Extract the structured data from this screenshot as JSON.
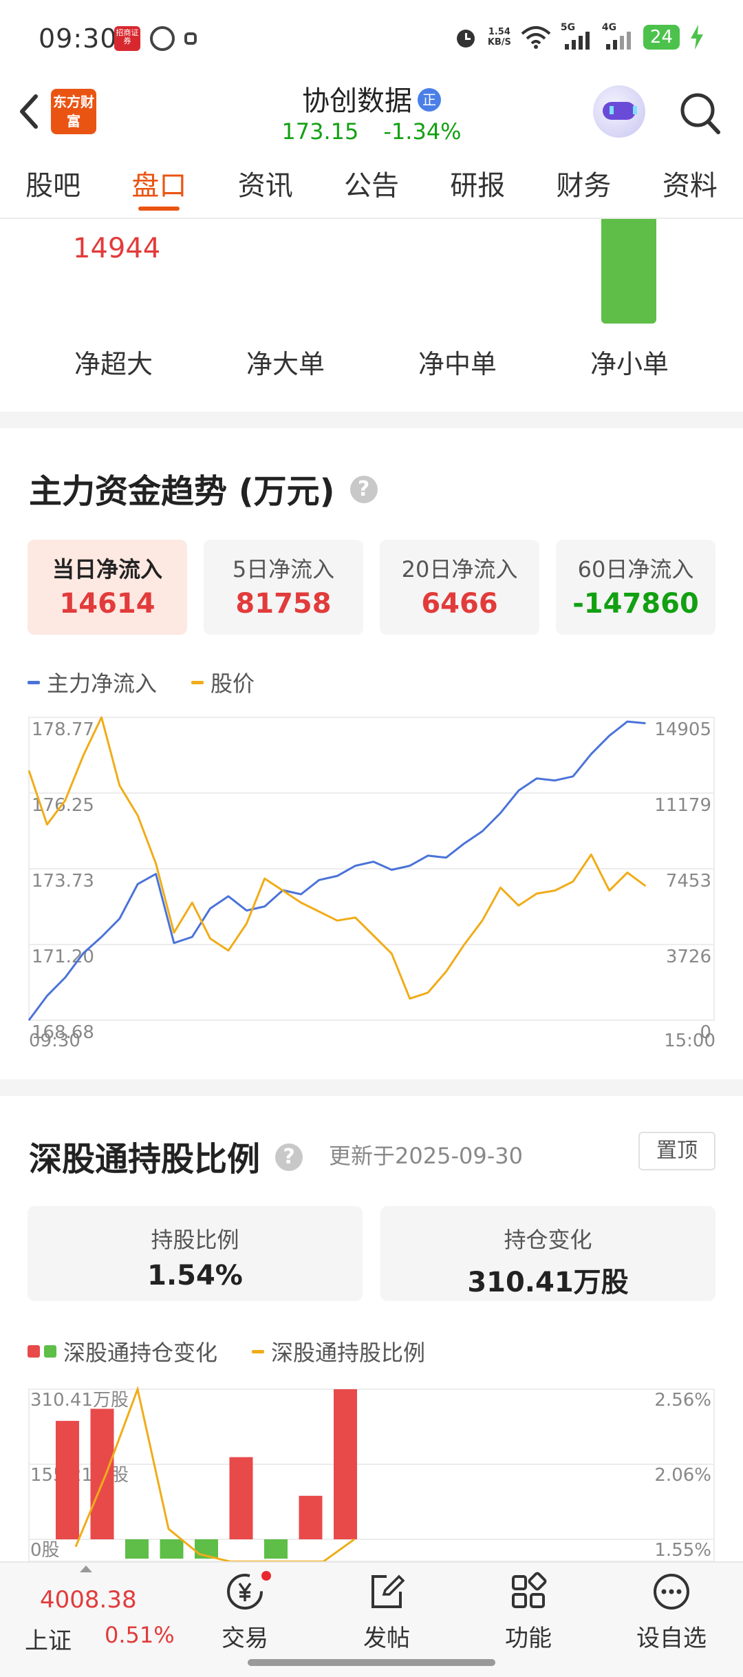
{
  "status_bar": {
    "time": "09:30",
    "app_badge": "招商证券",
    "net_speed_value": "1.54",
    "net_speed_unit": "KB/S",
    "signal_5g": "5G",
    "signal_4g": "4G",
    "battery": "24"
  },
  "header": {
    "logo_text": "东方财富",
    "stock_name": "协创数据",
    "badge": "正",
    "price": "173.15",
    "change_pct": "-1.34%"
  },
  "tabs": [
    {
      "label": "股吧",
      "active": false
    },
    {
      "label": "盘口",
      "active": true
    },
    {
      "label": "资讯",
      "active": false
    },
    {
      "label": "公告",
      "active": false
    },
    {
      "label": "研报",
      "active": false
    },
    {
      "label": "财务",
      "active": false
    },
    {
      "label": "资料",
      "active": false
    }
  ],
  "fund_bars": {
    "top_value": "14944",
    "labels": [
      "净超大",
      "净大单",
      "净中单",
      "净小单"
    ]
  },
  "trend_section": {
    "title": "主力资金趋势 (万元)",
    "help": "?",
    "cards": [
      {
        "label": "当日净流入",
        "value": "14614",
        "active": true,
        "color": "red"
      },
      {
        "label": "5日净流入",
        "value": "81758",
        "active": false,
        "color": "red"
      },
      {
        "label": "20日净流入",
        "value": "6466",
        "active": false,
        "color": "red"
      },
      {
        "label": "60日净流入",
        "value": "-147860",
        "active": false,
        "color": "green"
      }
    ],
    "legend": {
      "flow": "主力净流入",
      "price": "股价"
    },
    "colors": {
      "flow": "#4a73d8",
      "price": "#f0ac18"
    }
  },
  "chart_data": [
    {
      "type": "line",
      "title": "",
      "x": [
        "09:30",
        "15:00"
      ],
      "left_axis_ticks": [
        "178.77",
        "176.25",
        "173.73",
        "171.20",
        "168.68"
      ],
      "right_axis_ticks": [
        "14905",
        "11179",
        "7453",
        "3726",
        "0"
      ],
      "ylim_price": [
        168.68,
        178.77
      ],
      "ylim_flow": [
        0,
        14905
      ],
      "series": [
        {
          "name": "主力净流入",
          "axis": "right",
          "values": [
            0,
            1200,
            2100,
            3300,
            4100,
            5000,
            6700,
            7200,
            3800,
            4100,
            5500,
            6100,
            5400,
            5600,
            6400,
            6200,
            6900,
            7100,
            7600,
            7800,
            7400,
            7600,
            8100,
            8000,
            8700,
            9300,
            10200,
            11300,
            11900,
            11800,
            12000,
            13100,
            14000,
            14700,
            14614
          ]
        },
        {
          "name": "股价",
          "axis": "left",
          "values": [
            177.0,
            175.2,
            176.0,
            177.5,
            178.77,
            176.5,
            175.5,
            173.9,
            171.6,
            172.6,
            171.4,
            171.0,
            171.9,
            173.4,
            173.0,
            172.6,
            172.3,
            172.0,
            172.1,
            171.5,
            170.9,
            169.4,
            169.6,
            170.3,
            171.2,
            172.0,
            173.1,
            172.5,
            172.9,
            173.0,
            173.3,
            174.2,
            173.0,
            173.6,
            173.15
          ]
        }
      ]
    },
    {
      "type": "bar",
      "title": "",
      "left_axis_ticks": [
        "310.41万股",
        "155.21万股",
        "0股"
      ],
      "right_axis_ticks": [
        "2.56%",
        "2.06%",
        "1.55%"
      ],
      "ylim_change": [
        -60,
        310.41
      ],
      "ylim_ratio": [
        1.45,
        2.56
      ],
      "series": [
        {
          "name": "深股通持仓变化",
          "axis": "left",
          "values": [
            245,
            270,
            -40,
            -40,
            -40,
            170,
            -40,
            90,
            310.41
          ]
        },
        {
          "name": "深股通持股比例",
          "axis": "right",
          "values": [
            1.5,
            2.0,
            2.56,
            1.62,
            1.45,
            1.4,
            1.4,
            1.4,
            1.4,
            1.55
          ]
        }
      ]
    }
  ],
  "hk_section": {
    "title": "深股通持股比例",
    "help": "?",
    "updated": "更新于2025-09-30",
    "pin": "置顶",
    "cards": [
      {
        "label": "持股比例",
        "value": "1.54%"
      },
      {
        "label": "持仓变化",
        "value": "310.41万股"
      }
    ],
    "legend": {
      "change": "深股通持仓变化",
      "ratio": "深股通持股比例"
    },
    "colors": {
      "up": "#e84a4a",
      "down": "#5ebe48",
      "ratio": "#f0ac18"
    }
  },
  "bottom_bar": {
    "index_value": "4008.38",
    "index_name": "上证",
    "index_change": "0.51%",
    "nav": [
      {
        "label": "交易",
        "icon": "yen-exchange-icon"
      },
      {
        "label": "发帖",
        "icon": "edit-icon"
      },
      {
        "label": "功能",
        "icon": "grid-icon"
      },
      {
        "label": "设自选",
        "icon": "more-icon"
      }
    ]
  }
}
